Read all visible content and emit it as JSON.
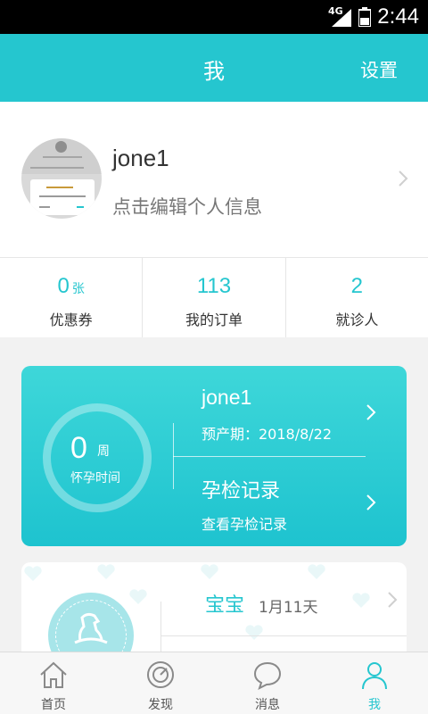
{
  "status_bar": {
    "network": "4G",
    "time": "2:44",
    "icons": [
      "signal-icon",
      "battery-icon"
    ]
  },
  "header": {
    "title": "我",
    "settings_label": "设置"
  },
  "profile": {
    "username": "jone1",
    "edit_hint": "点击编辑个人信息",
    "icons": [
      "avatar",
      "chevron-right-icon"
    ]
  },
  "stats": [
    {
      "value": "0",
      "unit": "张",
      "label": "优惠券"
    },
    {
      "value": "113",
      "unit": "",
      "label": "我的订单"
    },
    {
      "value": "2",
      "unit": "",
      "label": "就诊人"
    }
  ],
  "pregnancy": {
    "weeks": "0",
    "weeks_unit": "周",
    "weeks_label": "怀孕时间",
    "name": "jone1",
    "due_date": "预产期：2018/8/22",
    "record_title": "孕检记录",
    "record_subtitle": "查看孕检记录"
  },
  "baby": {
    "label": "宝宝",
    "age": "1月11天",
    "icons": [
      "heart-icon",
      "horse-icon"
    ]
  },
  "tabs": [
    {
      "label": "首页",
      "icon": "home-icon"
    },
    {
      "label": "发现",
      "icon": "compass-icon"
    },
    {
      "label": "消息",
      "icon": "message-icon"
    },
    {
      "label": "我",
      "icon": "user-icon",
      "active": true
    }
  ],
  "colors": {
    "accent": "#25c6cf",
    "card_gradient_top": "#3ed7d9",
    "card_gradient_bottom": "#1ec3cf"
  }
}
